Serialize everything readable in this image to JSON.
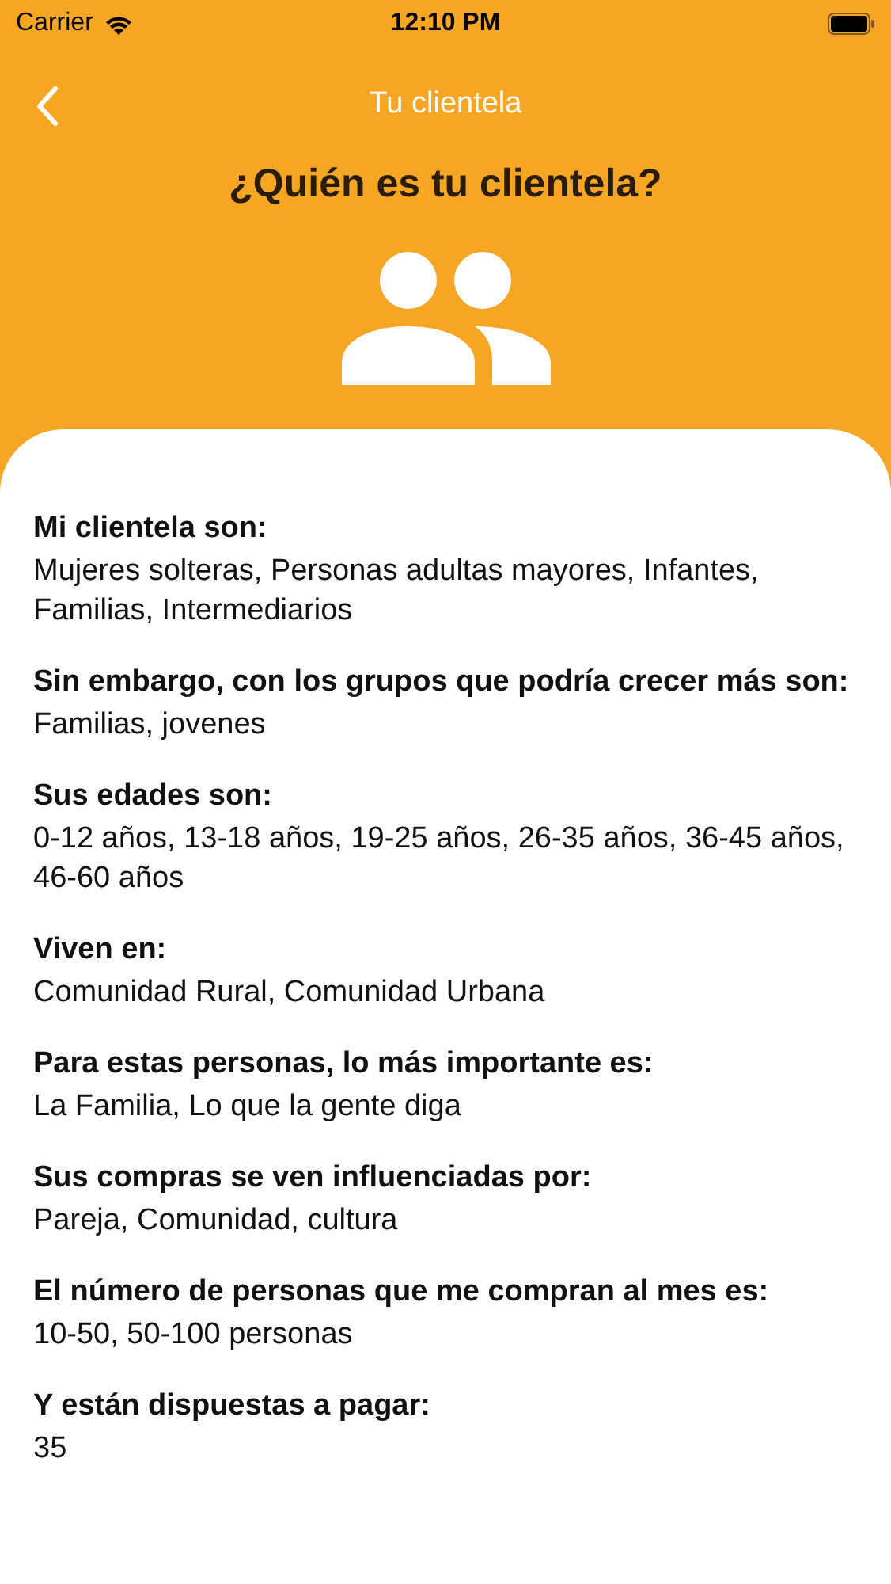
{
  "status_bar": {
    "carrier": "Carrier",
    "time": "12:10 PM"
  },
  "nav": {
    "title": "Tu clientela"
  },
  "heading": "¿Quién es tu clientela?",
  "sections": [
    {
      "label": "Mi clientela son:",
      "value": "Mujeres solteras, Personas adultas mayores, Infantes, Familias, Intermediarios"
    },
    {
      "label": "Sin embargo, con los grupos que podría crecer más son:",
      "value": "Familias, jovenes"
    },
    {
      "label": "Sus edades son:",
      "value": "0-12 años, 13-18 años, 19-25 años, 26-35 años, 36-45 años, 46-60 años"
    },
    {
      "label": "Viven en:",
      "value": "Comunidad Rural, Comunidad Urbana"
    },
    {
      "label": "Para estas personas, lo más importante es:",
      "value": "La Familia, Lo que la gente diga"
    },
    {
      "label": "Sus compras se ven influenciadas por:",
      "value": "Pareja, Comunidad, cultura"
    },
    {
      "label": "El número de personas que me compran al mes es:",
      "value": "10-50, 50-100 personas"
    },
    {
      "label": "Y están dispuestas a pagar:",
      "value": "35"
    }
  ]
}
